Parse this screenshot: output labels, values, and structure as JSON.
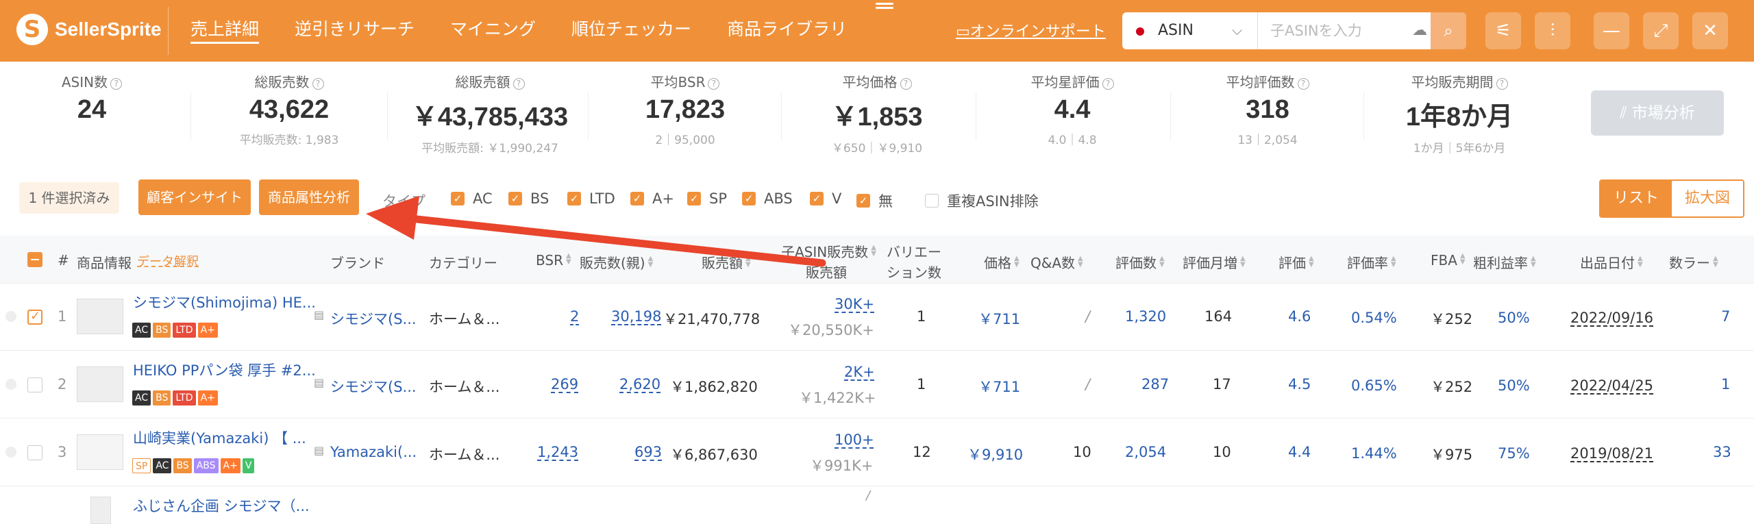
{
  "app": {
    "name": "SellerSprite"
  },
  "nav": [
    "売上詳細",
    "逆引きリサーチ",
    "マイニング",
    "順位チェッカー",
    "商品ライブラリ"
  ],
  "support": "オンラインサポート",
  "search": {
    "type": "ASIN",
    "placeholder": "子ASINを入力"
  },
  "stats": [
    {
      "label": "ASIN数",
      "value": "24",
      "sub": ""
    },
    {
      "label": "総販売数",
      "value": "43,622",
      "sub": "平均販売数: 1,983"
    },
    {
      "label": "総販売額",
      "value": "￥43,785,433",
      "sub": "平均販売額: ￥1,990,247"
    },
    {
      "label": "平均BSR",
      "value": "17,823",
      "sub": "2｜95,000"
    },
    {
      "label": "平均価格",
      "value": "￥1,853",
      "sub": "￥650｜￥9,910"
    },
    {
      "label": "平均星評価",
      "value": "4.4",
      "sub": "4.0｜4.8"
    },
    {
      "label": "平均評価数",
      "value": "318",
      "sub": "13｜2,054"
    },
    {
      "label": "平均販売期間",
      "value": "1年8か月",
      "sub": "1か月｜5年6か月"
    }
  ],
  "market_button": "市場分析",
  "filters": {
    "selected": "1 件選択済み",
    "customer_btn": "顧客インサイト",
    "attr_btn": "商品属性分析",
    "type_label": "タイプ",
    "types": [
      "AC",
      "BS",
      "LTD",
      "A+",
      "SP",
      "ABS",
      "V",
      "無"
    ],
    "dedupe": "重複ASIN排除",
    "view_list": "リスト",
    "view_zoom": "拡大図"
  },
  "headers": {
    "num": "#",
    "product": "商品情報",
    "data_link": "データ解釈",
    "brand": "ブランド",
    "category": "カテゴリー",
    "bsr": "BSR",
    "sales_qty": "販売数(親)",
    "sales_amt": "販売額",
    "child_qty": "子ASIN販売数",
    "child_amt": "販売額",
    "variation1": "バリエー",
    "variation2": "ション数",
    "price": "価格",
    "qa": "Q&A数",
    "reviews": "評価数",
    "review_growth": "評価月増",
    "rating": "評価",
    "rating_rate": "評価率",
    "fba": "FBA",
    "margin": "粗利益率",
    "date": "出品日付",
    "sellers": "数ラー"
  },
  "rows": [
    {
      "num": "1",
      "title": "シモジマ(Shimojima) HE...",
      "badges": [
        "AC",
        "BS",
        "LTD",
        "A+"
      ],
      "brand": "シモジマ(S...",
      "category": "ホーム＆...",
      "bsr": "2",
      "sales_qty": "30,198",
      "sales_amt": "￥21,470,778",
      "child_qty": "30K+",
      "child_amt": "￥20,550K+",
      "variation": "1",
      "price": "￥711",
      "qa": "/",
      "reviews": "1,320",
      "review_growth": "164",
      "rating": "4.6",
      "rating_rate": "0.54%",
      "fba": "￥252",
      "margin": "50%",
      "date": "2022/09/16",
      "sellers": "7"
    },
    {
      "num": "2",
      "title": "HEIKO PPパン袋 厚手 #2...",
      "badges": [
        "AC",
        "BS",
        "LTD",
        "A+"
      ],
      "brand": "シモジマ(S...",
      "category": "ホーム＆...",
      "bsr": "269",
      "sales_qty": "2,620",
      "sales_amt": "￥1,862,820",
      "child_qty": "2K+",
      "child_amt": "￥1,422K+",
      "variation": "1",
      "price": "￥711",
      "qa": "/",
      "reviews": "287",
      "review_growth": "17",
      "rating": "4.5",
      "rating_rate": "0.65%",
      "fba": "￥252",
      "margin": "50%",
      "date": "2022/04/25",
      "sellers": "1"
    },
    {
      "num": "3",
      "title": "山崎実業(Yamazaki) 【 ...",
      "badges": [
        "SP",
        "AC",
        "BS",
        "ABS",
        "A+",
        "V"
      ],
      "brand": "Yamazaki(...",
      "category": "ホーム＆...",
      "bsr": "1,243",
      "sales_qty": "693",
      "sales_amt": "￥6,867,630",
      "child_qty": "100+",
      "child_amt": "￥991K+",
      "variation": "12",
      "price": "￥9,910",
      "qa": "10",
      "reviews": "2,054",
      "review_growth": "10",
      "rating": "4.4",
      "rating_rate": "1.44%",
      "fba": "￥975",
      "margin": "75%",
      "date": "2019/08/21",
      "sellers": "33"
    },
    {
      "num": "",
      "title": "ふじさん企画 シモジマ（...",
      "badges": [],
      "brand": "",
      "category": "",
      "bsr": "",
      "sales_qty": "",
      "sales_amt": "",
      "child_qty": "",
      "child_amt": "/",
      "variation": "",
      "price": "",
      "qa": "",
      "reviews": "",
      "review_growth": "",
      "rating": "",
      "rating_rate": "",
      "fba": "",
      "margin": "",
      "date": "",
      "sellers": ""
    }
  ],
  "colors": {
    "accent": "#f0913a",
    "link": "#2a5db0",
    "arrow": "#e8452c"
  }
}
